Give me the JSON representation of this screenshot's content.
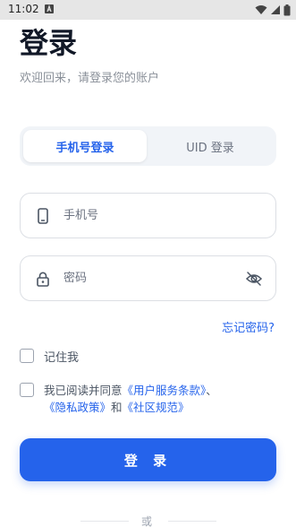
{
  "status_bar": {
    "time": "11:02"
  },
  "header": {
    "title": "登录",
    "subtitle": "欢迎回来，请登录您的账户"
  },
  "tabs": [
    {
      "label": "手机号登录",
      "active": true
    },
    {
      "label": "UID 登录",
      "active": false
    }
  ],
  "phone_field": {
    "placeholder": "手机号",
    "value": "",
    "icon": "phone-icon"
  },
  "password_field": {
    "placeholder": "密码",
    "value": "",
    "icon": "lock-icon",
    "toggle_icon": "eye-off-icon"
  },
  "forgot_password": "忘记密码?",
  "remember_me": {
    "label": "记住我",
    "checked": false
  },
  "agreement": {
    "checked": false,
    "prefix": "我已阅读并同意",
    "terms_link": "《用户服务条款》",
    "separator": "、",
    "privacy_link": "《隐私政策》",
    "conjunction": "和",
    "community_link": "《社区规范》"
  },
  "login_button": "登 录",
  "divider_text": "或",
  "colors": {
    "accent": "#2563eb",
    "text_primary": "#111827",
    "text_muted": "#8a9099",
    "border": "#dcdfe4"
  }
}
